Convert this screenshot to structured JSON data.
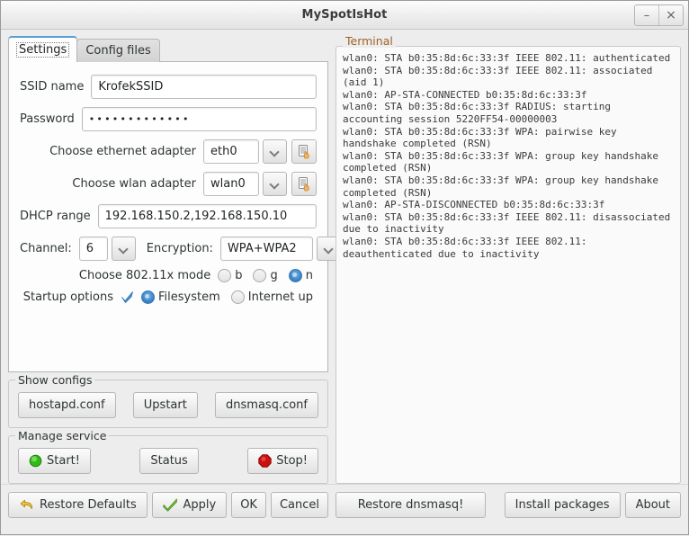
{
  "window": {
    "title": "MySpotIsHot",
    "minimize_label": "–",
    "close_label": "×"
  },
  "tabs": [
    {
      "label": "Settings",
      "active": true
    },
    {
      "label": "Config files",
      "active": false
    }
  ],
  "settings": {
    "ssid": {
      "label": "SSID name",
      "value": "KrofekSSID"
    },
    "password": {
      "label": "Password",
      "value": "•••••••••••••"
    },
    "ethernet": {
      "label": "Choose ethernet adapter",
      "value": "eth0"
    },
    "wlan": {
      "label": "Choose wlan adapter",
      "value": "wlan0"
    },
    "dhcp": {
      "label": "DHCP range",
      "value": "192.168.150.2,192.168.150.10"
    },
    "channel": {
      "label": "Channel:",
      "value": "6"
    },
    "encryption": {
      "label": "Encryption:",
      "value": "WPA+WPA2"
    },
    "mode": {
      "label": "Choose 802.11x mode",
      "options": [
        {
          "label": "b",
          "selected": false
        },
        {
          "label": "g",
          "selected": false
        },
        {
          "label": "n",
          "selected": true
        }
      ]
    },
    "startup": {
      "label": "Startup options",
      "checkbox_checked": true,
      "options": [
        {
          "label": "Filesystem",
          "selected": true
        },
        {
          "label": "Internet up",
          "selected": false
        }
      ]
    }
  },
  "show_configs": {
    "title": "Show configs",
    "buttons": [
      "hostapd.conf",
      "Upstart",
      "dnsmasq.conf"
    ]
  },
  "manage_service": {
    "title": "Manage service",
    "start_label": "Start!",
    "status_label": "Status",
    "stop_label": "Stop!"
  },
  "terminal": {
    "title": "Terminal",
    "lines": [
      "wlan0: STA b0:35:8d:6c:33:3f IEEE 802.11: authenticated",
      "wlan0: STA b0:35:8d:6c:33:3f IEEE 802.11: associated (aid 1)",
      "wlan0: AP-STA-CONNECTED b0:35:8d:6c:33:3f",
      "wlan0: STA b0:35:8d:6c:33:3f RADIUS: starting accounting session 5220FF54-00000003",
      "wlan0: STA b0:35:8d:6c:33:3f WPA: pairwise key handshake completed (RSN)",
      "wlan0: STA b0:35:8d:6c:33:3f WPA: group key handshake completed (RSN)",
      "wlan0: STA b0:35:8d:6c:33:3f WPA: group key handshake completed (RSN)",
      "wlan0: AP-STA-DISCONNECTED b0:35:8d:6c:33:3f",
      "wlan0: STA b0:35:8d:6c:33:3f IEEE 802.11: disassociated due to inactivity",
      "wlan0: STA b0:35:8d:6c:33:3f IEEE 802.11: deauthenticated due to inactivity"
    ]
  },
  "actions": {
    "restore_defaults": "Restore Defaults",
    "apply": "Apply",
    "ok": "OK",
    "cancel": "Cancel",
    "restore_dnsmasq": "Restore dnsmasq!",
    "install_packages": "Install packages",
    "about": "About"
  },
  "colors": {
    "accent_tab": "#5a9fd4",
    "terminal_label": "#a1622a",
    "start_green": "#34c224",
    "stop_red": "#d31414",
    "check_blue": "#3b84c8",
    "undo_yellow": "#e8b93c",
    "apply_green": "#78c034"
  }
}
